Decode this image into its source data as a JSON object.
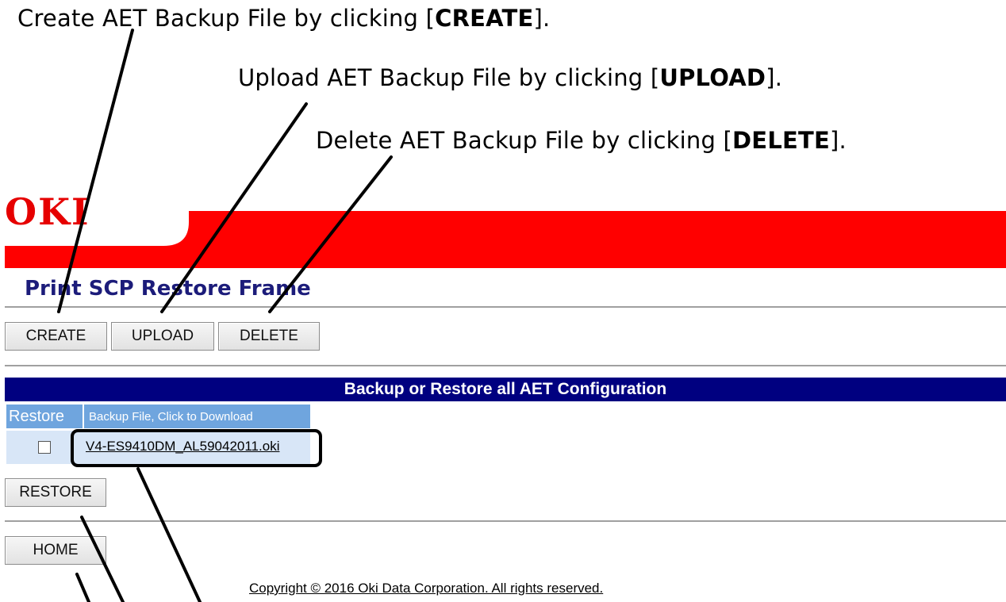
{
  "callouts": {
    "create": {
      "text": "Create AET Backup File by clicking [",
      "keyword": "CREATE",
      "suffix": "]."
    },
    "upload": {
      "text": "Upload AET Backup File by clicking [",
      "keyword": "UPLOAD",
      "suffix": "]."
    },
    "delete": {
      "text": "Delete AET Backup File by clicking [",
      "keyword": "DELETE",
      "suffix": "]."
    }
  },
  "header": {
    "logo": "OKI",
    "title": "Print SCP Restore Frame"
  },
  "toolbar": {
    "create_label": "CREATE",
    "upload_label": "UPLOAD",
    "delete_label": "DELETE"
  },
  "table": {
    "title": "Backup or Restore all AET Configuration",
    "columns": [
      "Restore",
      "Backup File, Click to Download"
    ],
    "rows": [
      {
        "restore_checked": false,
        "file": "V4-ES9410DM_AL59042011.oki"
      }
    ]
  },
  "actions": {
    "restore_label": "RESTORE",
    "home_label": "HOME"
  },
  "footer": {
    "copyright": "Copyright © 2016 Oki Data Corporation. All rights reserved."
  },
  "colors": {
    "brand_red": "#e60000",
    "title_navy": "#1c1c7a",
    "table_header": "#000080",
    "column_header": "#6fa5de",
    "row_bg": "#d8e6f7"
  }
}
